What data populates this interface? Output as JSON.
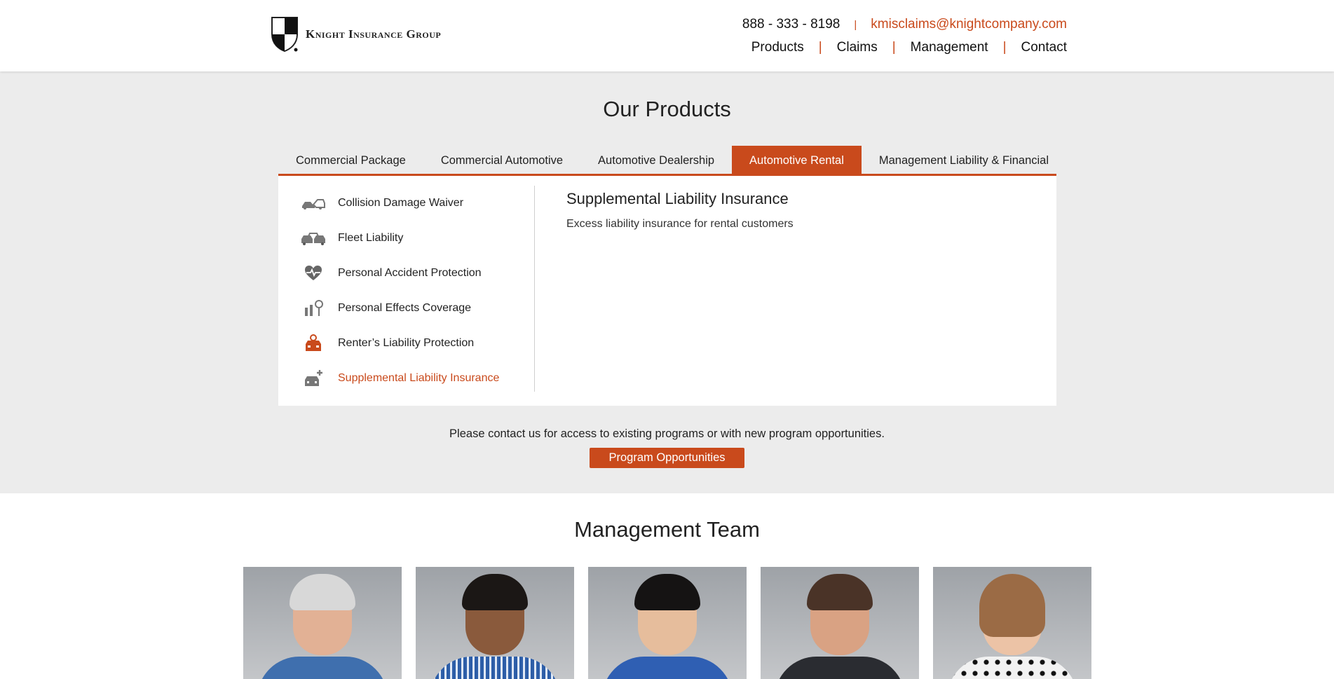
{
  "header": {
    "logo_text": "Knight Insurance Group",
    "phone": "888 - 333 - 8198",
    "separator": "|",
    "email": "kmisclaims@knightcompany.com",
    "nav": [
      "Products",
      "Claims",
      "Management",
      "Contact"
    ]
  },
  "products": {
    "title": "Our Products",
    "tabs": [
      "Commercial Package",
      "Commercial Automotive",
      "Automotive Dealership",
      "Automotive Rental",
      "Management Liability & Financial"
    ],
    "active_tab": "Automotive Rental",
    "items": [
      {
        "label": "Collision Damage Waiver",
        "icon": "car-crash-icon"
      },
      {
        "label": "Fleet Liability",
        "icon": "fleet-cars-icon"
      },
      {
        "label": "Personal Accident Protection",
        "icon": "heart-pulse-icon"
      },
      {
        "label": "Personal Effects Coverage",
        "icon": "personal-effects-icon"
      },
      {
        "label": "Renter’s Liability Protection",
        "icon": "car-key-icon"
      },
      {
        "label": "Supplemental Liability Insurance",
        "icon": "car-plus-icon"
      }
    ],
    "detail": {
      "title": "Supplemental Liability Insurance",
      "description": "Excess liability insurance for rental customers"
    },
    "contact_note": "Please contact us for access to existing programs or with new program opportunities.",
    "cta_label": "Program Opportunities"
  },
  "management": {
    "title": "Management Team"
  },
  "colors": {
    "accent": "#c94a1c",
    "band": "#ececec"
  }
}
